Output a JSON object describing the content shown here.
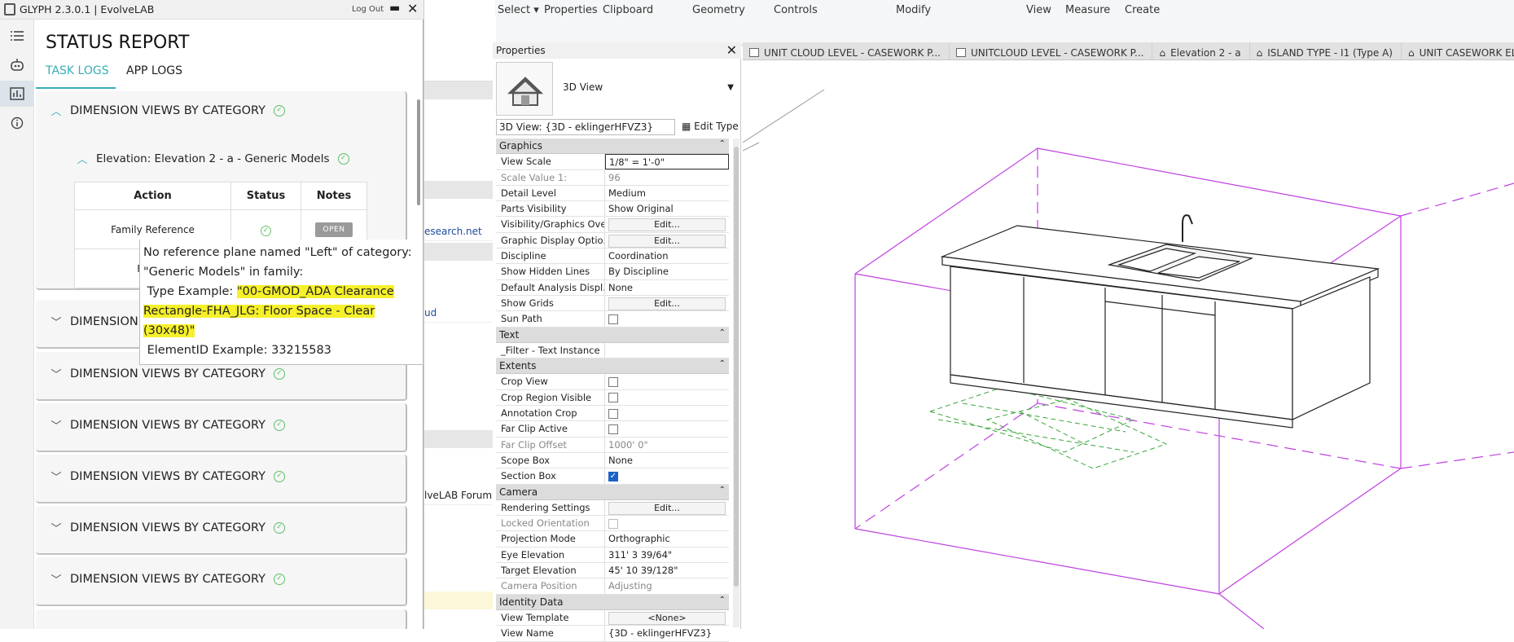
{
  "glyph": {
    "window_title": "GLYPH 2.3.0.1 | EvolveLAB",
    "logout_label": "Log Out",
    "minimize_glyph": "▬",
    "close_glyph": "✕",
    "heading": "STATUS REPORT",
    "tabs": [
      "TASK LOGS",
      "APP LOGS"
    ],
    "cards": [
      {
        "title": "DIMENSION VIEWS BY CATEGORY",
        "expanded": true,
        "sub": {
          "title": "Elevation: Elevation 2 - a - Generic Models",
          "table": {
            "headers": [
              "Action",
              "Status",
              "Notes"
            ],
            "rows": [
              {
                "action": "Family Reference",
                "status": "ok",
                "notes": "OPEN"
              },
              {
                "action": "Family",
                "status": "",
                "notes": ""
              }
            ]
          }
        }
      },
      {
        "title": "DIMENSION VIEWS BY CATEGORY"
      },
      {
        "title": "DIMENSION VIEWS BY CATEGORY"
      },
      {
        "title": "DIMENSION VIEWS BY CATEGORY"
      },
      {
        "title": "DIMENSION VIEWS BY CATEGORY"
      },
      {
        "title": "DIMENSION VIEWS BY CATEGORY"
      },
      {
        "title": "DIMENSION VIEWS BY CATEGORY"
      }
    ],
    "tooltip": {
      "line1": "No reference plane named \"Left\" of category:",
      "line2": "\"Generic Models\" in family:",
      "line3_prefix": "Type Example: ",
      "line3_hl": "\"00-GMOD_ADA Clearance",
      "line4_hl": "Rectangle-FHA_JLG: Floor Space - Clear",
      "line5_hl": "(30x48)\"",
      "line6": "ElementID Example: 33215583"
    }
  },
  "mid_strip": {
    "link1": "esearch.net",
    "link2": "ud",
    "link3": "lveLAB Forum"
  },
  "ribbon": {
    "items": [
      "Select ▾",
      "Properties",
      "Clipboard",
      "Geometry",
      "Controls",
      "Modify",
      "View",
      "Measure",
      "Create"
    ]
  },
  "properties": {
    "title": "Properties",
    "type_name": "3D View",
    "view_selector": "3D View: {3D - eklingerHFVZ3}",
    "edit_type": "Edit Type",
    "sections": [
      {
        "name": "Graphics",
        "rows": [
          {
            "n": "View Scale",
            "v": "1/8\" = 1'-0\"",
            "kind": "input"
          },
          {
            "n": "Scale Value    1:",
            "v": "96",
            "kind": "dis"
          },
          {
            "n": "Detail Level",
            "v": "Medium"
          },
          {
            "n": "Parts Visibility",
            "v": "Show Original"
          },
          {
            "n": "Visibility/Graphics Ove...",
            "v": "Edit...",
            "kind": "btn"
          },
          {
            "n": "Graphic Display Optio...",
            "v": "Edit...",
            "kind": "btn"
          },
          {
            "n": "Discipline",
            "v": "Coordination"
          },
          {
            "n": "Show Hidden Lines",
            "v": "By Discipline"
          },
          {
            "n": "Default Analysis Displ...",
            "v": "None"
          },
          {
            "n": "Show Grids",
            "v": "Edit...",
            "kind": "btn"
          },
          {
            "n": "Sun Path",
            "v": "",
            "kind": "cb"
          }
        ]
      },
      {
        "name": "Text",
        "rows": [
          {
            "n": "_Filter - Text Instance",
            "v": ""
          }
        ]
      },
      {
        "name": "Extents",
        "rows": [
          {
            "n": "Crop View",
            "v": "",
            "kind": "cb"
          },
          {
            "n": "Crop Region Visible",
            "v": "",
            "kind": "cb"
          },
          {
            "n": "Annotation Crop",
            "v": "",
            "kind": "cb"
          },
          {
            "n": "Far Clip Active",
            "v": "",
            "kind": "cb"
          },
          {
            "n": "Far Clip Offset",
            "v": "1000'  0\"",
            "kind": "dis"
          },
          {
            "n": "Scope Box",
            "v": "None"
          },
          {
            "n": "Section Box",
            "v": "",
            "kind": "cbon"
          }
        ]
      },
      {
        "name": "Camera",
        "rows": [
          {
            "n": "Rendering Settings",
            "v": "Edit...",
            "kind": "btn"
          },
          {
            "n": "Locked Orientation",
            "v": "",
            "kind": "cbdis"
          },
          {
            "n": "Projection Mode",
            "v": "Orthographic"
          },
          {
            "n": "Eye Elevation",
            "v": "311'  3 39/64\""
          },
          {
            "n": "Target Elevation",
            "v": "45'  10 39/128\""
          },
          {
            "n": "Camera Position",
            "v": "Adjusting",
            "kind": "dis"
          }
        ]
      },
      {
        "name": "Identity Data",
        "rows": [
          {
            "n": "View Template",
            "v": "<None>",
            "kind": "btn"
          },
          {
            "n": "View Name",
            "v": "{3D - eklingerHFVZ3}"
          }
        ]
      }
    ]
  },
  "view_tabs": [
    "UNIT CLOUD LEVEL - CASEWORK P...",
    "UNITCLOUD LEVEL - CASEWORK P...",
    "Elevation 2 - a",
    "ISLAND TYPE - I1 (Type A)",
    "UNIT CASEWORK ELEVA"
  ]
}
